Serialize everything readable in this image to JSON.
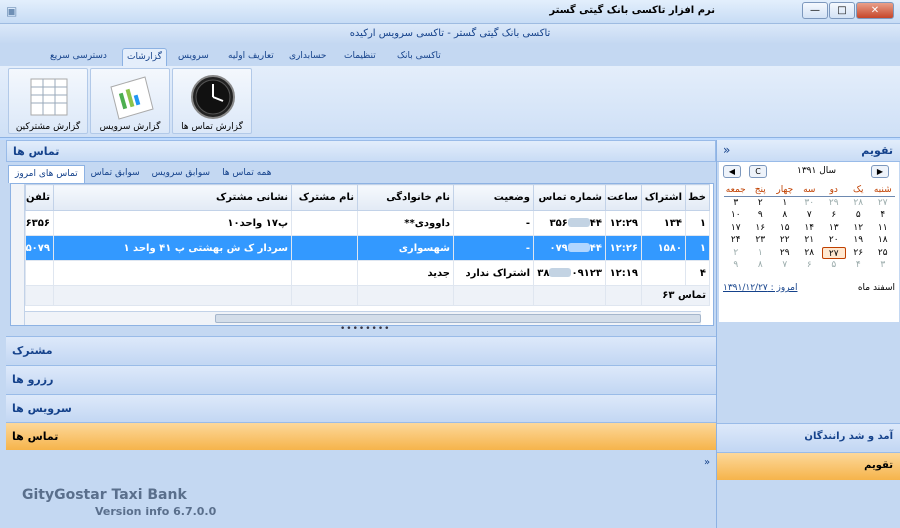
{
  "window": {
    "title": "نرم افزار تاکسی بانک گیتی گستر",
    "subtitle": "تاکسی بانک گیتی گستر  -  تاکسی سرویس ارکیده",
    "minimize": "—",
    "maximize": "□",
    "close": "✕"
  },
  "ribbon_tabs": [
    "تاکسی بانک",
    "تنظیمات",
    "حسابداری",
    "تعاریف اولیه",
    "سرویس",
    "گزارشات",
    "دسترسی سریع"
  ],
  "ribbon_buttons": {
    "calls_report": "گزارش تماس ها",
    "service_report": "گزارش سرویس",
    "subscribers_report": "گزارش مشترکین"
  },
  "calls_panel": {
    "title": "تماس ها",
    "subtabs": [
      "همه تماس ها",
      "سوابق سرویس",
      "سوابق تماس",
      "تماس های امروز"
    ],
    "columns": [
      "خط",
      "اشتراک",
      "ساعت",
      "شماره تماس",
      "وضعیت",
      "نام خانوادگی",
      "نام مشترک",
      "نشانی مشترک",
      "تلفن"
    ],
    "rows": [
      {
        "line": "۱",
        "sub": "۱۳۴",
        "time": "۱۲:۲۹",
        "num_a": "۴۴",
        "num_b": "۳۵۶",
        "status": "-",
        "family": "داوودی**",
        "name": "",
        "address": "پ۱۷ واحد۱۰",
        "phone": "۶۳۵۶"
      },
      {
        "line": "۱",
        "sub": "۱۵۸۰",
        "time": "۱۲:۲۶",
        "num_a": "۴۴",
        "num_b": "۰۷۹",
        "status": "-",
        "family": "شهسواری",
        "name": "",
        "address": "سردار ک ش بهشتی پ ۴۱ واحد ۱",
        "phone": "۵۰۷۹"
      },
      {
        "line": "۴",
        "sub": "",
        "time": "۱۲:۱۹",
        "num_a": "۰۹۱۲۳",
        "num_b": "۳۸",
        "status": "اشتراک ندارد",
        "family": "جدید",
        "name": "",
        "address": "",
        "phone": ""
      }
    ],
    "footer": "تماس ۶۳"
  },
  "nav_sections": [
    "مشترک",
    "رزرو ها",
    "سرویس ها",
    "تماس ها"
  ],
  "calendar": {
    "title": "تقویم",
    "year_label": "سال ۱۳۹۱",
    "center_btn": "C",
    "weekdays": [
      "شنبه",
      "یک",
      "دو",
      "سه",
      "چهار",
      "پنج",
      "جمعه"
    ],
    "weeks": [
      [
        "۲۷",
        "۲۸",
        "۲۹",
        "۳۰",
        "۱",
        "۲",
        "۳"
      ],
      [
        "۴",
        "۵",
        "۶",
        "۷",
        "۸",
        "۹",
        "۱۰"
      ],
      [
        "۱۱",
        "۱۲",
        "۱۳",
        "۱۴",
        "۱۵",
        "۱۶",
        "۱۷"
      ],
      [
        "۱۸",
        "۱۹",
        "۲۰",
        "۲۱",
        "۲۲",
        "۲۳",
        "۲۴"
      ],
      [
        "۲۵",
        "۲۶",
        "۲۷",
        "۲۸",
        "۲۹",
        "۱",
        "۲"
      ],
      [
        "۳",
        "۴",
        "۵",
        "۶",
        "۷",
        "۸",
        "۹"
      ]
    ],
    "month_label": "اسفند ماه",
    "today_label": "امروز : ۱۳۹۱/۱۲/۲۷"
  },
  "side_sections": [
    "آمد و شد رانندگان",
    "تقویم"
  ],
  "brand": "GityGostar Taxi Bank",
  "version": "Version info 6.7.0.0"
}
